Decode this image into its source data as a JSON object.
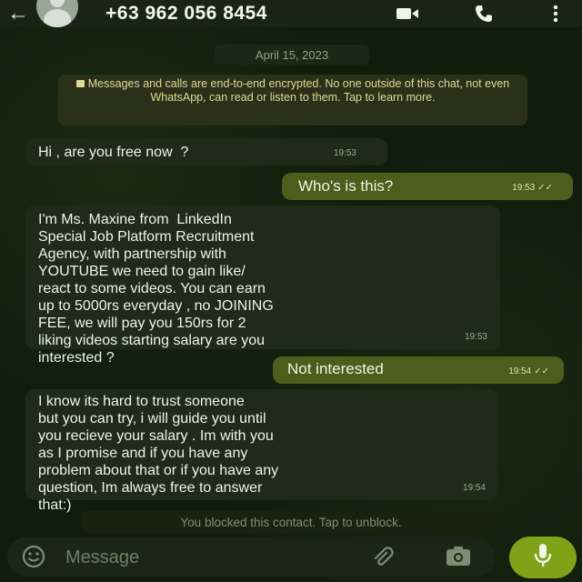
{
  "header": {
    "contact_name": "+63 962 056 8454",
    "icons": [
      "back-arrow-icon",
      "avatar",
      "video-call-icon",
      "phone-icon",
      "more-vert-icon"
    ]
  },
  "chat": {
    "date_label": "April 15, 2023",
    "encryption_notice": "Messages and calls are end-to-end encrypted. No one outside of this chat, not even WhatsApp, can read or listen to them. Tap to learn more.",
    "messages": [
      {
        "direction": "in",
        "text": "Hi , are you free now  ?",
        "time": "19:53"
      },
      {
        "direction": "out",
        "text": "Who's is this?",
        "time": "19:53",
        "status": "read"
      },
      {
        "direction": "in",
        "text": "I'm Ms. Maxine from  LinkedIn\nSpecial Job Platform Recruitment\nAgency, with partnership with\nYOUTUBE we need to gain like/\nreact to some videos. You can earn\nup to 5000rs everyday , no JOINING\nFEE, we will pay you 150rs for 2\nliking videos starting salary are you\ninterested ?",
        "time": "19:53"
      },
      {
        "direction": "out",
        "text": "Not interested",
        "time": "19:54",
        "status": "read"
      },
      {
        "direction": "in",
        "text": "I know its hard to trust someone\nbut you can try, i will guide you until\nyou recieve your salary . Im with you\nas I promise and if you have any\nproblem about that or if you have any\nquestion, Im always free to answer\nthat:)",
        "time": "19:54"
      }
    ],
    "blocked_notice": "You blocked this contact. Tap to unblock."
  },
  "composer": {
    "placeholder": "Message",
    "value": ""
  },
  "colors": {
    "header_bg": "#1a2414",
    "incoming_bubble": "#1f2a18",
    "outgoing_bubble": "#4e5d1c",
    "mic_button": "#7ea318"
  }
}
